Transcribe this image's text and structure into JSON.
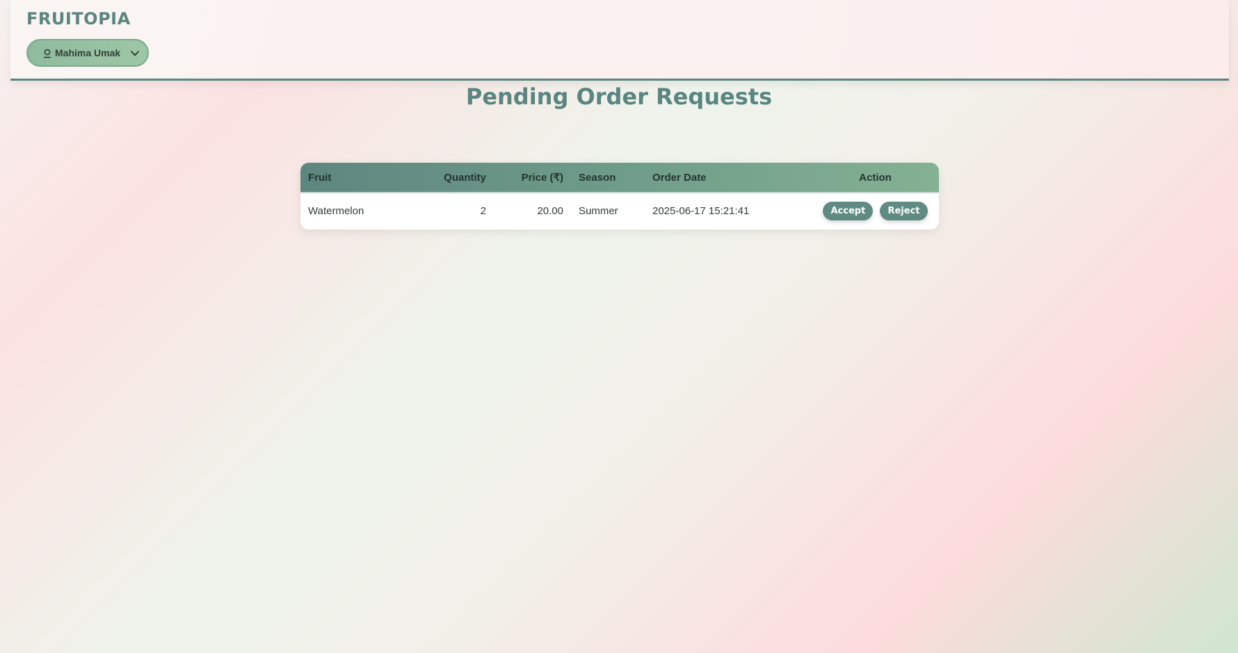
{
  "navbar": {
    "brand": "FRUITOPIA",
    "user_menu": {
      "name": "Mahima Umak",
      "icon": "user-icon",
      "dropdown_icon": "chevron-down-icon"
    }
  },
  "page": {
    "title": "Pending Order Requests"
  },
  "orders_table": {
    "headers": {
      "fruit": "Fruit",
      "quantity": "Quantity",
      "price": "Price (₹)",
      "season": "Season",
      "order_date": "Order Date",
      "action": "Action"
    },
    "rows": [
      {
        "fruit": "Watermelon",
        "quantity": "2",
        "price": "20.00",
        "season": "Summer",
        "order_date": "2025-06-17 15:21:41",
        "accept_label": "Accept",
        "reject_label": "Reject"
      }
    ]
  },
  "colors": {
    "brand": "#5a8580",
    "header_start": "#5e8680",
    "header_end": "#84b193",
    "button": "#5f8b82"
  }
}
